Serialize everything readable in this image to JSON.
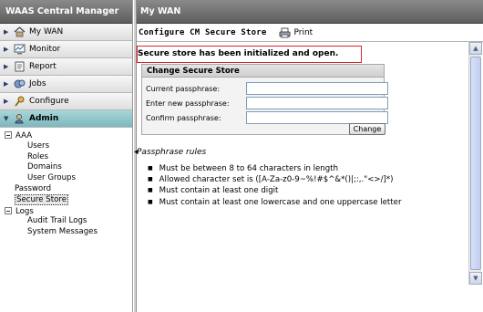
{
  "sidebar": {
    "title": "WAAS Central Manager",
    "nav": [
      {
        "label": "My WAN",
        "icon": "home-icon"
      },
      {
        "label": "Monitor",
        "icon": "monitor-icon"
      },
      {
        "label": "Report",
        "icon": "report-icon"
      },
      {
        "label": "Jobs",
        "icon": "jobs-icon"
      },
      {
        "label": "Configure",
        "icon": "configure-icon"
      },
      {
        "label": "Admin",
        "icon": "admin-icon"
      }
    ],
    "tree": {
      "aaa": "AAA",
      "users": "Users",
      "roles": "Roles",
      "domains": "Domains",
      "user_groups": "User Groups",
      "password": "Password",
      "secure_store": "Secure Store",
      "logs": "Logs",
      "audit_trail_logs": "Audit Trail Logs",
      "system_messages": "System Messages"
    }
  },
  "main": {
    "title": "My WAN",
    "toolbar": {
      "page_title": "Configure CM Secure Store",
      "print_label": "Print"
    },
    "status_message": "Secure store has been initialized and open.",
    "panel": {
      "title": "Change Secure Store",
      "fields": {
        "current_label": "Current passphrase:",
        "current_value": "",
        "new_label": "Enter new passphrase:",
        "new_value": "",
        "confirm_label": "Confirm passphrase:",
        "confirm_value": ""
      },
      "change_button": "Change"
    },
    "rules_heading": "Passphrase rules",
    "rules": [
      "Must be between 8 to 64 characters in length",
      "Allowed character set is ([A-Za-z0-9~%!#$^&*()|;:,.\"<>/]*)",
      "Must contain at least one digit",
      "Must contain at least one lowercase and one uppercase letter"
    ]
  },
  "colors": {
    "header_bg": "#6f6f6f",
    "active_nav": "#8fc4c8",
    "status_border": "#d8262d",
    "input_border": "#7f9db9"
  }
}
